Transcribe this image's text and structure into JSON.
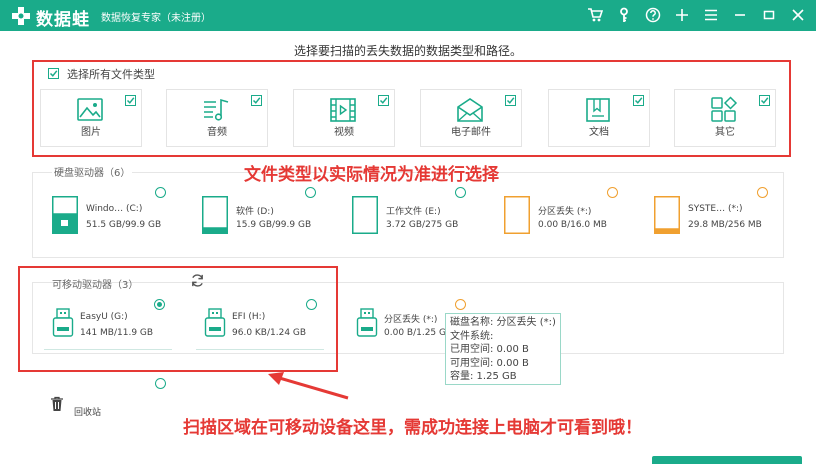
{
  "titlebar": {
    "app_name": "数据蛙",
    "subtitle": "数据恢复专家（未注册）",
    "icons": [
      "cart-icon",
      "key-icon",
      "help-icon",
      "plus-icon",
      "menu-icon",
      "minimize-icon",
      "maximize-icon",
      "close-icon"
    ]
  },
  "prompt": "选择要扫描的丢失数据的数据类型和路径。",
  "file_types": {
    "select_all_label": "选择所有文件类型",
    "items": [
      {
        "label": "图片",
        "icon": "image-icon",
        "checked": true
      },
      {
        "label": "音频",
        "icon": "audio-icon",
        "checked": true
      },
      {
        "label": "视频",
        "icon": "video-icon",
        "checked": true
      },
      {
        "label": "电子邮件",
        "icon": "email-icon",
        "checked": true
      },
      {
        "label": "文档",
        "icon": "document-icon",
        "checked": true
      },
      {
        "label": "其它",
        "icon": "other-icon",
        "checked": true
      }
    ]
  },
  "annotations": {
    "file_type_note": "文件类型以实际情况为准进行选择",
    "scan_area_note": "扫描区域在可移动设备这里，需成功连接上电脑才可看到哦！"
  },
  "hard_drives": {
    "title": "硬盘驱动器（6）",
    "items": [
      {
        "name": "Windo… (C:)",
        "size": "51.5 GB/99.9 GB",
        "fill": 0.52,
        "color": "#1aab8a"
      },
      {
        "name": "软件 (D:)",
        "size": "15.9 GB/99.9 GB",
        "fill": 0.16,
        "color": "#1aab8a"
      },
      {
        "name": "工作文件 (E:)",
        "size": "3.72 GB/275 GB",
        "fill": 0.01,
        "color": "#1aab8a"
      },
      {
        "name": "分区丢失 (*:)",
        "size": "0.00  B/16.0 MB",
        "fill": 0,
        "color": "#f0a030"
      },
      {
        "name": "SYSTE… (*:)",
        "size": "29.8 MB/256 MB",
        "fill": 0.12,
        "color": "#f0a030"
      }
    ]
  },
  "removable": {
    "title": "可移动驱动器（3）",
    "items": [
      {
        "name": "EasyU (G:)",
        "size": "141 MB/11.9 GB",
        "selected": true
      },
      {
        "name": "EFI (H:)",
        "size": "96.0 KB/1.24 GB",
        "selected": false
      },
      {
        "name": "分区丢失 (*:)",
        "size": "0.00  B/1.25 G",
        "selected": false
      }
    ]
  },
  "tooltip": {
    "lines": [
      "磁盘名称:  分区丢失 (*:)",
      "文件系统:",
      "已用空间:  0.00  B",
      "可用空间:  0.00  B",
      "容量:  1.25 GB"
    ]
  },
  "recycle": {
    "label": "回收站"
  },
  "colors": {
    "brand": "#1aab8a",
    "annotation": "#e53935",
    "lost_partition": "#f0a030"
  }
}
